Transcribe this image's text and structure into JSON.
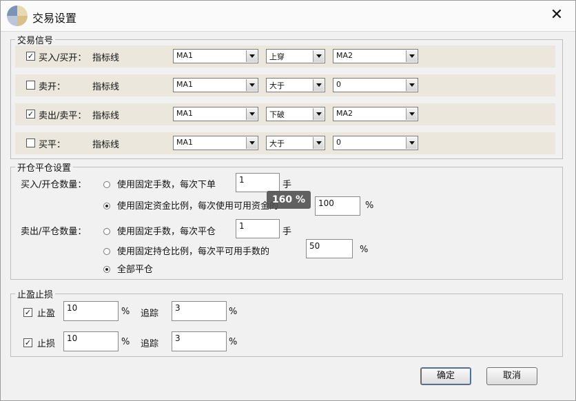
{
  "window": {
    "title": "交易设置",
    "close": "✕"
  },
  "signals": {
    "legend": "交易信号",
    "rows": [
      {
        "checked": true,
        "label": "买入/买开：",
        "type_label": "指标线",
        "field": "MA1",
        "op": "上穿",
        "target": "MA2"
      },
      {
        "checked": false,
        "label": "卖开：",
        "type_label": "指标线",
        "field": "MA1",
        "op": "大于",
        "target": "0"
      },
      {
        "checked": true,
        "label": "卖出/卖平：",
        "type_label": "指标线",
        "field": "MA1",
        "op": "下破",
        "target": "MA2"
      },
      {
        "checked": false,
        "label": "买平：",
        "type_label": "指标线",
        "field": "MA1",
        "op": "大于",
        "target": "0"
      }
    ]
  },
  "position": {
    "legend": "开仓平仓设置",
    "open_label": "买入/开仓数量：",
    "open_fixed_label": "使用固定手数，每次下单",
    "open_fixed_value": "1",
    "open_fixed_unit": "手",
    "open_ratio_label": "使用固定资金比例，每次使用可用资金的",
    "open_ratio_value": "100",
    "open_ratio_unit": "%",
    "close_label": "卖出/平仓数量：",
    "close_fixed_label": "使用固定手数，每次平仓",
    "close_fixed_value": "1",
    "close_fixed_unit": "手",
    "close_ratio_label": "使用固定持仓比例，每次平可用手数的",
    "close_ratio_value": "50",
    "close_ratio_unit": "%",
    "close_all_label": "全部平仓"
  },
  "stops": {
    "legend": "止盈止损",
    "profit_label": "止盈",
    "profit_checked": true,
    "profit_value": "10",
    "profit_unit": "%",
    "profit_trail_label": "追踪",
    "profit_trail_value": "3",
    "profit_trail_unit": "%",
    "loss_label": "止损",
    "loss_checked": true,
    "loss_value": "10",
    "loss_unit": "%",
    "loss_trail_label": "追踪",
    "loss_trail_value": "3",
    "loss_trail_unit": "%"
  },
  "zoom_badge": "160 %",
  "buttons": {
    "ok": "确定",
    "cancel": "取消"
  },
  "icons": {
    "app": "app-logo-icon",
    "check": "✓"
  }
}
